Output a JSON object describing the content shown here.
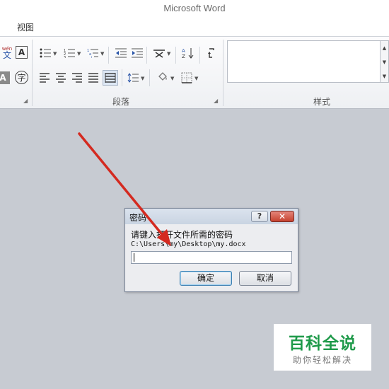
{
  "window": {
    "title": "Microsoft Word"
  },
  "menu": {
    "tabs": [
      {
        "label": "视图"
      }
    ]
  },
  "ribbon": {
    "font_group": {
      "wen_label": "wén",
      "wen_char": "文",
      "a_label": "A",
      "zi_label": "字"
    },
    "paragraph_group": {
      "label": "段落"
    },
    "styles_group": {
      "label": "样式"
    }
  },
  "dialog": {
    "title": "密码",
    "help_label": "?",
    "close_label": "✕",
    "prompt": "请键入打开文件所需的密码",
    "file_path": "C:\\Users\\my\\Desktop\\my.docx",
    "password_value": "",
    "ok_label": "确定",
    "cancel_label": "取消"
  },
  "annotation": {
    "arrow_color": "#d42a20"
  },
  "watermark": {
    "main_text": "百科全说",
    "sub_text": "助你轻松解决"
  }
}
